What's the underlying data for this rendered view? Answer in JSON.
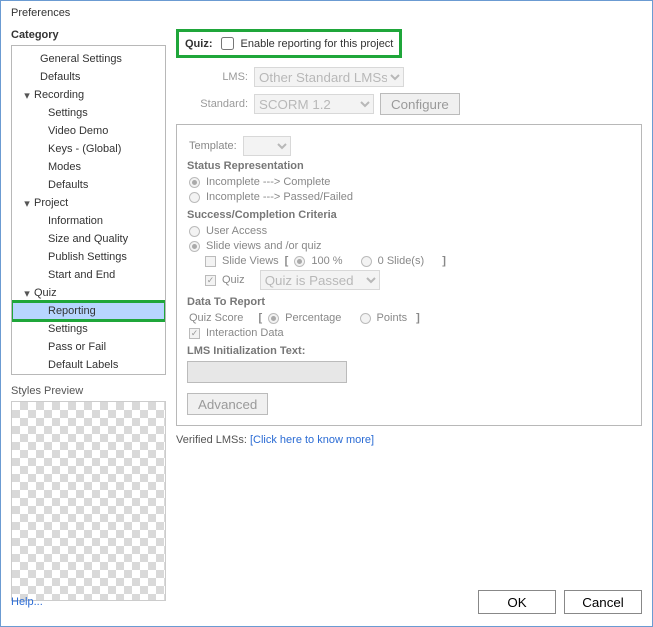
{
  "window": {
    "title": "Preferences"
  },
  "sidebar": {
    "heading": "Category",
    "groups": [
      {
        "label": "General Settings"
      },
      {
        "label": "Defaults"
      },
      {
        "label": "Recording",
        "children": [
          "Settings",
          "Video Demo",
          "Keys - (Global)",
          "Modes",
          "Defaults"
        ]
      },
      {
        "label": "Project",
        "children": [
          "Information",
          "Size and Quality",
          "Publish Settings",
          "Start and End"
        ]
      },
      {
        "label": "Quiz",
        "children": [
          "Reporting",
          "Settings",
          "Pass or Fail",
          "Default Labels"
        ]
      }
    ],
    "selected": "Reporting",
    "styles_preview_label": "Styles Preview"
  },
  "quiz": {
    "label": "Quiz:",
    "enable_label": "Enable reporting for this project",
    "enable_checked": false
  },
  "lms": {
    "label": "LMS:",
    "value": "Other Standard LMSs"
  },
  "standard": {
    "label": "Standard:",
    "value": "SCORM 1.2",
    "configure": "Configure"
  },
  "panel": {
    "template_label": "Template:",
    "status_title": "Status Representation",
    "status_opt1": "Incomplete ---> Complete",
    "status_opt2": "Incomplete ---> Passed/Failed",
    "criteria_title": "Success/Completion Criteria",
    "criteria_opt1": "User Access",
    "criteria_opt2": "Slide views and /or quiz",
    "slide_views_label": "Slide Views",
    "slide_views_pct": "100 %",
    "slide_views_slides": "0 Slide(s)",
    "quiz_label": "Quiz",
    "quiz_value": "Quiz is Passed",
    "data_title": "Data To Report",
    "quiz_score_label": "Quiz Score",
    "quiz_score_pct": "Percentage",
    "quiz_score_pts": "Points",
    "interaction_data": "Interaction Data",
    "lms_init_label": "LMS Initialization Text:",
    "advanced": "Advanced"
  },
  "verified": {
    "label": "Verified LMSs:",
    "link": "[Click here to know more]"
  },
  "footer": {
    "help": "Help...",
    "ok": "OK",
    "cancel": "Cancel"
  }
}
